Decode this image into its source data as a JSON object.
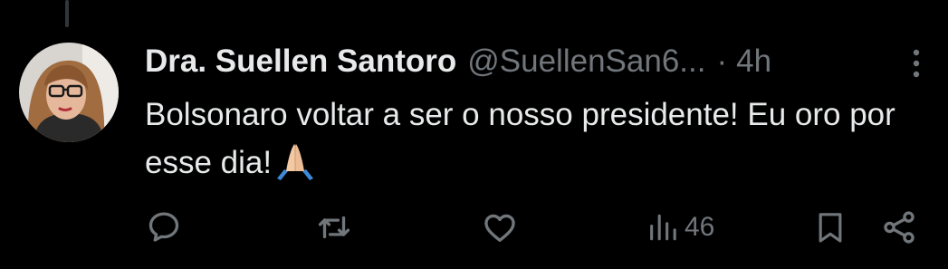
{
  "tweet": {
    "author_name": "Dra. Suellen Santoro",
    "author_handle": "@SuellenSan6...",
    "separator": "·",
    "timestamp": "4h",
    "text": "Bolsonaro voltar a ser o nosso presidente! Eu oro por esse dia!",
    "emoji": "folded-hands"
  },
  "actions": {
    "reply_icon": "reply-icon",
    "retweet_icon": "retweet-icon",
    "like_icon": "heart-icon",
    "views_icon": "views-icon",
    "views_count": "46",
    "bookmark_icon": "bookmark-icon",
    "share_icon": "share-icon"
  },
  "colors": {
    "background": "#000000",
    "text_primary": "#e7e9ea",
    "text_secondary": "#71767b",
    "thread_line": "#333639"
  }
}
